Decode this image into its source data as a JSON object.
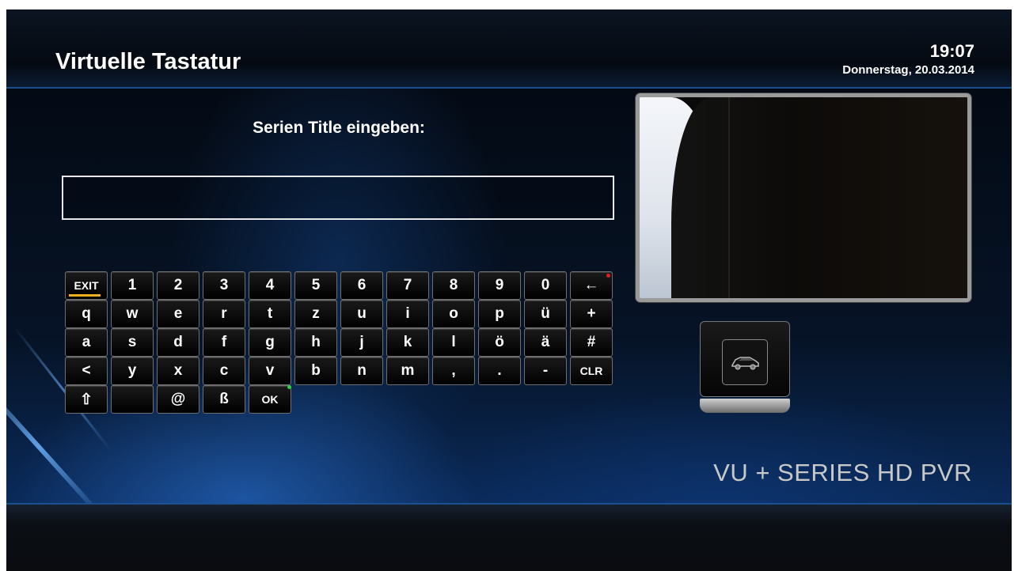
{
  "header": {
    "title": "Virtuelle Tastatur",
    "time": "19:07",
    "date": "Donnerstag, 20.03.2014"
  },
  "prompt": "Serien Title eingeben:",
  "input": {
    "value": ""
  },
  "keyboard": {
    "rows": [
      [
        "EXIT",
        "1",
        "2",
        "3",
        "4",
        "5",
        "6",
        "7",
        "8",
        "9",
        "0",
        "←"
      ],
      [
        "q",
        "w",
        "e",
        "r",
        "t",
        "z",
        "u",
        "i",
        "o",
        "p",
        "ü",
        "+"
      ],
      [
        "a",
        "s",
        "d",
        "f",
        "g",
        "h",
        "j",
        "k",
        "l",
        "ö",
        "ä",
        "#"
      ],
      [
        "<",
        "y",
        "x",
        "c",
        "v",
        "b",
        "n",
        "m",
        ",",
        ".",
        "-",
        "CLR"
      ],
      [
        "⇧",
        "",
        "@",
        "ß",
        "OK"
      ]
    ]
  },
  "preview": {
    "icon": "tv-preview"
  },
  "badge": {
    "icon": "car-icon"
  },
  "brand": "VU + SERIES HD PVR",
  "colors": {
    "accent_blue": "#1d4f8f",
    "exit_underline": "#f0b020",
    "backspace_dot": "#e02020",
    "ok_dot": "#30d040"
  }
}
